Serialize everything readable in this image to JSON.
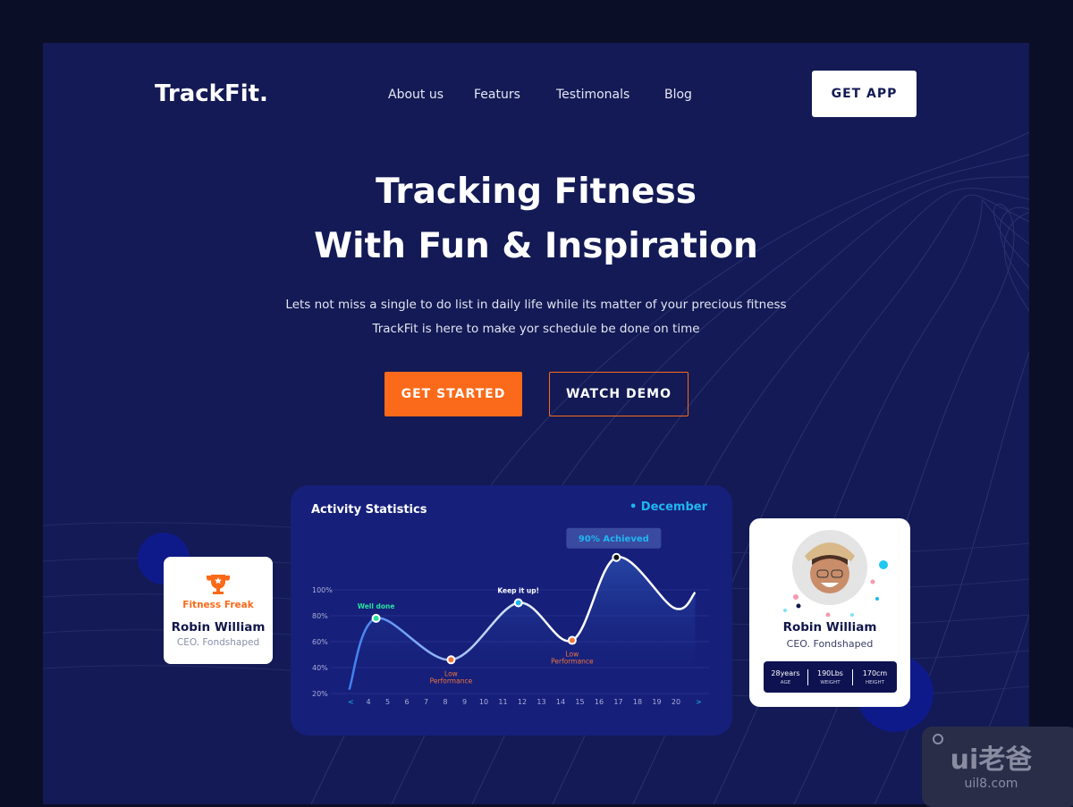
{
  "brand": "TrackFit.",
  "nav": [
    {
      "label": "About us"
    },
    {
      "label": "Featurs"
    },
    {
      "label": "Testimonals"
    },
    {
      "label": "Blog"
    }
  ],
  "get_app": "GET APP",
  "hero": {
    "line1": "Tracking Fitness",
    "line2": "With Fun & Inspiration",
    "sub1": "Lets not miss a single to do list in daily life while its  matter of your precious fitness",
    "sub2": "TrackFit is here to make yor schedule be done on time",
    "primary": "GET STARTED",
    "secondary": "WATCH DEMO"
  },
  "colors": {
    "accent": "#fb6a1a",
    "panel": "#131a55",
    "chart_bg": "#161f7a",
    "highlight": "#1fb6f0"
  },
  "badge_card": {
    "icon": "trophy-icon",
    "title": "Fitness Freak",
    "name": "Robin William",
    "role": "CEO. Fondshaped"
  },
  "profile_card": {
    "name": "Robin William",
    "role": "CEO. Fondshaped",
    "stats": [
      {
        "value": "28years",
        "label": "AGE"
      },
      {
        "value": "190Lbs",
        "label": "WEIGHT"
      },
      {
        "value": "170cm",
        "label": "HEIGHT"
      }
    ]
  },
  "chart_data": {
    "type": "area",
    "title": "Activity Statistics",
    "period": "• December",
    "yticks": [
      "100%",
      "80%",
      "60%",
      "40%",
      "20%"
    ],
    "ylim": [
      20,
      100
    ],
    "xticks": [
      "4",
      "5",
      "6",
      "7",
      "8",
      "9",
      "10",
      "11",
      "12",
      "13",
      "14",
      "15",
      "16",
      "17",
      "18",
      "19",
      "20"
    ],
    "prev": "<",
    "next": ">",
    "points": [
      {
        "x": 3,
        "y": 23
      },
      {
        "x": 4.4,
        "y": 78
      },
      {
        "x": 8.3,
        "y": 46
      },
      {
        "x": 11.8,
        "y": 90
      },
      {
        "x": 14.6,
        "y": 61
      },
      {
        "x": 16.9,
        "y": 125
      },
      {
        "x": 19.9,
        "y": 86
      },
      {
        "x": 21,
        "y": 98
      }
    ],
    "annotations": [
      {
        "x": 4.4,
        "y": 78,
        "label": "Well done",
        "color": "#27e0a0",
        "pos": "above"
      },
      {
        "x": 8.3,
        "y": 46,
        "label": "Low Performance",
        "color": "#f0743a",
        "pos": "below"
      },
      {
        "x": 11.8,
        "y": 90,
        "label": "Keep it up!",
        "color": "#ffffff",
        "pos": "above"
      },
      {
        "x": 14.6,
        "y": 61,
        "label": "Low Performance",
        "color": "#f0743a",
        "pos": "below"
      },
      {
        "x": 16.9,
        "y": 125,
        "label": "90% Achieved",
        "color": "#1fb6f0",
        "pos": "badge"
      }
    ],
    "grid": true
  },
  "watermark": {
    "text": "ui老爸",
    "url": "uil8.com"
  }
}
